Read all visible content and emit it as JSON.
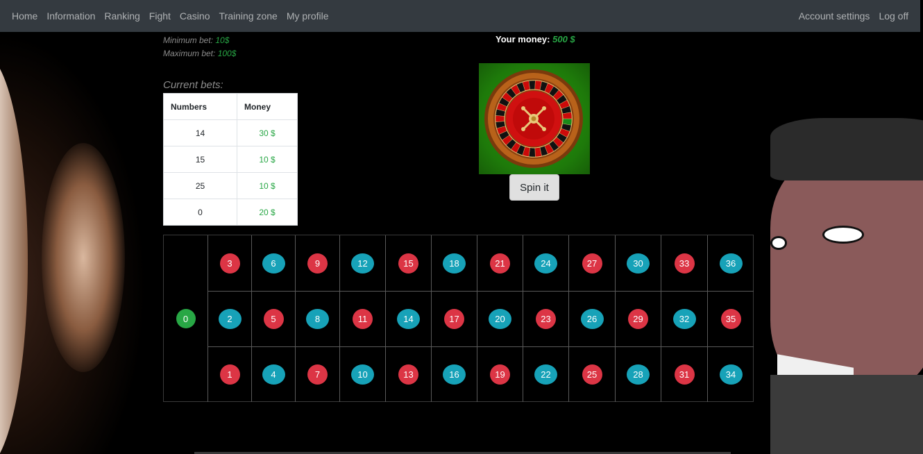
{
  "nav": {
    "left": [
      "Home",
      "Information",
      "Ranking",
      "Fight",
      "Casino",
      "Training zone",
      "My profile"
    ],
    "right": [
      "Account settings",
      "Log off"
    ]
  },
  "limits": {
    "min_label": "Minimum bet:",
    "min_value": "10$",
    "max_label": "Maximum bet:",
    "max_value": "100$"
  },
  "money": {
    "label": "Your money:",
    "value": "500 $"
  },
  "bets": {
    "title": "Current bets:",
    "headers": [
      "Numbers",
      "Money"
    ],
    "rows": [
      {
        "number": "14",
        "money": "30 $"
      },
      {
        "number": "15",
        "money": "10 $"
      },
      {
        "number": "25",
        "money": "10 $"
      },
      {
        "number": "0",
        "money": "20 $"
      }
    ]
  },
  "spin_button": "Spin it",
  "board": {
    "zero": {
      "label": "0",
      "color": "green"
    },
    "rows": [
      [
        {
          "n": "3",
          "c": "red"
        },
        {
          "n": "6",
          "c": "blue"
        },
        {
          "n": "9",
          "c": "red"
        },
        {
          "n": "12",
          "c": "blue"
        },
        {
          "n": "15",
          "c": "red"
        },
        {
          "n": "18",
          "c": "blue"
        },
        {
          "n": "21",
          "c": "red"
        },
        {
          "n": "24",
          "c": "blue"
        },
        {
          "n": "27",
          "c": "red"
        },
        {
          "n": "30",
          "c": "blue"
        },
        {
          "n": "33",
          "c": "red"
        },
        {
          "n": "36",
          "c": "blue"
        }
      ],
      [
        {
          "n": "2",
          "c": "blue"
        },
        {
          "n": "5",
          "c": "red"
        },
        {
          "n": "8",
          "c": "blue"
        },
        {
          "n": "11",
          "c": "red"
        },
        {
          "n": "14",
          "c": "blue"
        },
        {
          "n": "17",
          "c": "red"
        },
        {
          "n": "20",
          "c": "blue"
        },
        {
          "n": "23",
          "c": "red"
        },
        {
          "n": "26",
          "c": "blue"
        },
        {
          "n": "29",
          "c": "red"
        },
        {
          "n": "32",
          "c": "blue"
        },
        {
          "n": "35",
          "c": "red"
        }
      ],
      [
        {
          "n": "1",
          "c": "red"
        },
        {
          "n": "4",
          "c": "blue"
        },
        {
          "n": "7",
          "c": "red"
        },
        {
          "n": "10",
          "c": "blue"
        },
        {
          "n": "13",
          "c": "red"
        },
        {
          "n": "16",
          "c": "blue"
        },
        {
          "n": "19",
          "c": "red"
        },
        {
          "n": "22",
          "c": "blue"
        },
        {
          "n": "25",
          "c": "red"
        },
        {
          "n": "28",
          "c": "blue"
        },
        {
          "n": "31",
          "c": "red"
        },
        {
          "n": "34",
          "c": "blue"
        }
      ]
    ]
  },
  "colors": {
    "red": "#dc3545",
    "blue": "#17a2b8",
    "green": "#28a745",
    "navbar": "#343a40"
  },
  "icons": {
    "wheel": "roulette-wheel-icon"
  }
}
